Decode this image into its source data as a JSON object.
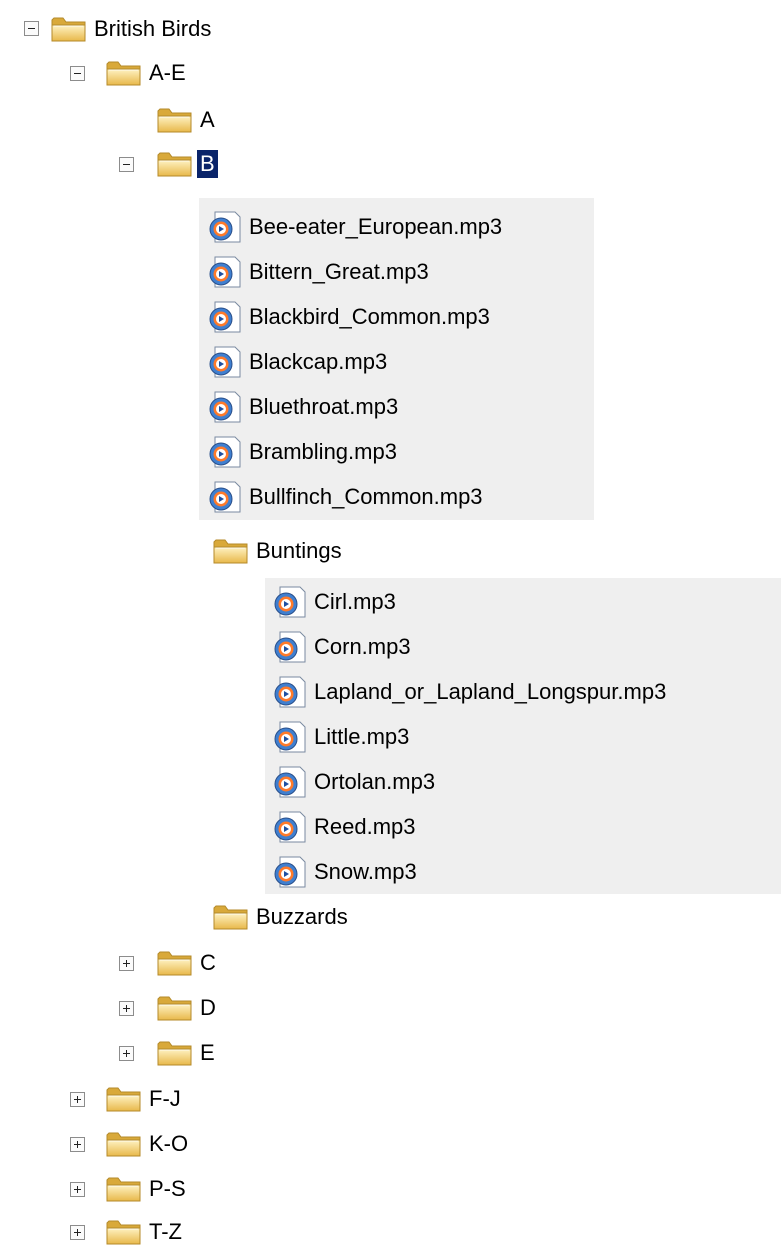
{
  "tree": {
    "root": {
      "label": "British Birds"
    },
    "a_e": {
      "label": "A-E",
      "a": {
        "label": "A"
      },
      "b": {
        "label": "B",
        "files": [
          "Bee-eater_European.mp3",
          "Bittern_Great.mp3",
          "Blackbird_Common.mp3",
          "Blackcap.mp3",
          "Bluethroat.mp3",
          "Brambling.mp3",
          "Bullfinch_Common.mp3"
        ],
        "buntings": {
          "label": "Buntings",
          "files": [
            "Cirl.mp3",
            "Corn.mp3",
            "Lapland_or_Lapland_Longspur.mp3",
            "Little.mp3",
            "Ortolan.mp3",
            "Reed.mp3",
            "Snow.mp3"
          ]
        },
        "buzzards": {
          "label": "Buzzards"
        }
      },
      "c": {
        "label": "C"
      },
      "d": {
        "label": "D"
      },
      "e": {
        "label": "E"
      }
    },
    "f_j": {
      "label": "F-J"
    },
    "k_o": {
      "label": "K-O"
    },
    "p_s": {
      "label": "P-S"
    },
    "t_z": {
      "label": "T-Z"
    }
  },
  "icons": {
    "folder": "folder-icon",
    "audio_file": "media-file-icon",
    "collapse": "minus-box-icon",
    "expand": "plus-box-icon"
  },
  "colors": {
    "selection": "#0a246a",
    "folder": "#f5d47a",
    "panel": "#efefef"
  }
}
